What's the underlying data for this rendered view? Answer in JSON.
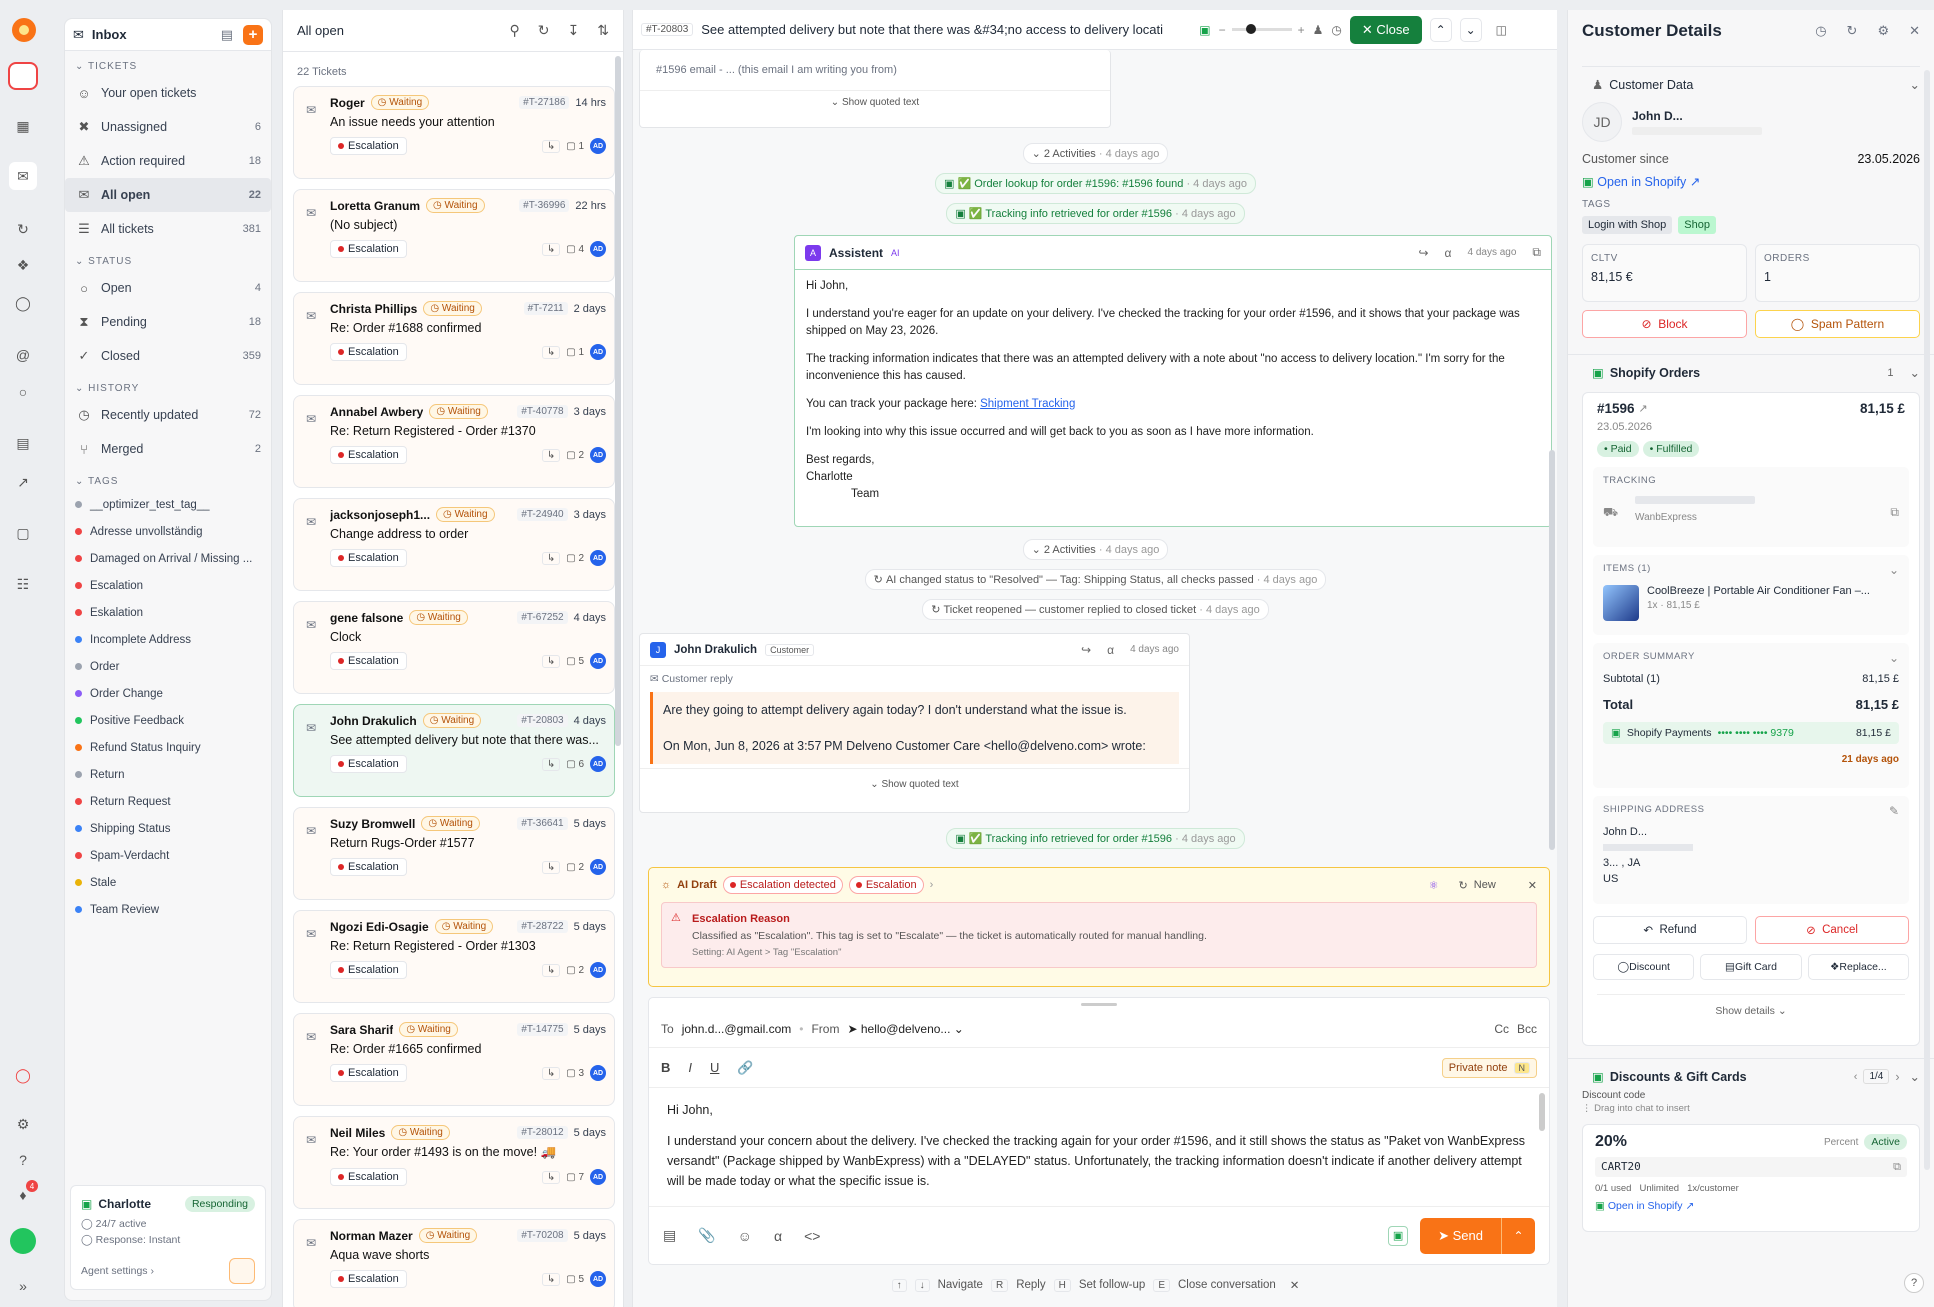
{
  "rail": {
    "icons": [
      "logo-icon",
      "app-box-icon",
      "grid-icon",
      "inbox-icon",
      "refresh-icon",
      "cube-icon",
      "shield-icon",
      "at-icon",
      "chat-icon",
      "bar-chart-icon",
      "line-chart-icon",
      "message-icon",
      "book-icon",
      "alert-shield-icon",
      "settings-icon",
      "help-icon",
      "bell-icon",
      "avatar-icon",
      "expand-icon"
    ],
    "bell_badge": "4"
  },
  "nav": {
    "title": "Inbox",
    "sections": {
      "tickets": "TICKETS",
      "status": "STATUS",
      "history": "HISTORY",
      "tags": "TAGS"
    },
    "tickets": [
      {
        "label": "Your open tickets",
        "count": "",
        "icon": "☺"
      },
      {
        "label": "Unassigned",
        "count": "6",
        "icon": "✖"
      },
      {
        "label": "Action required",
        "count": "18",
        "icon": "⚠"
      },
      {
        "label": "All open",
        "count": "22",
        "icon": "✉"
      },
      {
        "label": "All tickets",
        "count": "381",
        "icon": "☰"
      }
    ],
    "status": [
      {
        "label": "Open",
        "count": "4",
        "icon": "○"
      },
      {
        "label": "Pending",
        "count": "18",
        "icon": "⧗"
      },
      {
        "label": "Closed",
        "count": "359",
        "icon": "✓"
      }
    ],
    "history": [
      {
        "label": "Recently updated",
        "count": "72",
        "icon": "◷"
      },
      {
        "label": "Merged",
        "count": "2",
        "icon": "⑂"
      }
    ],
    "tags": [
      {
        "label": "__optimizer_test_tag__",
        "color": "#9ca3af"
      },
      {
        "label": "Adresse unvollständig",
        "color": "#ef4444"
      },
      {
        "label": "Damaged on Arrival / Missing ...",
        "color": "#ef4444"
      },
      {
        "label": "Escalation",
        "color": "#ef4444"
      },
      {
        "label": "Eskalation",
        "color": "#ef4444"
      },
      {
        "label": "Incomplete Address",
        "color": "#3b82f6"
      },
      {
        "label": "Order",
        "color": "#9ca3af"
      },
      {
        "label": "Order Change",
        "color": "#8b5cf6"
      },
      {
        "label": "Positive Feedback",
        "color": "#22c55e"
      },
      {
        "label": "Refund Status Inquiry",
        "color": "#f97316"
      },
      {
        "label": "Return",
        "color": "#9ca3af"
      },
      {
        "label": "Return Request",
        "color": "#ef4444"
      },
      {
        "label": "Shipping Status",
        "color": "#3b82f6"
      },
      {
        "label": "Spam-Verdacht",
        "color": "#ef4444"
      },
      {
        "label": "Stale",
        "color": "#eab308"
      },
      {
        "label": "Team Review",
        "color": "#3b82f6"
      }
    ],
    "agent": {
      "name": "Charlotte",
      "status": "Responding",
      "active": "24/7 active",
      "response": "Response: Instant",
      "settings": "Agent settings"
    }
  },
  "list": {
    "title": "All open",
    "count": "22 Tickets",
    "status": "Waiting",
    "tag": "Escalation",
    "avatar": "AD",
    "tickets": [
      {
        "name": "Roger",
        "id": "#T-27186",
        "time": "14 hrs",
        "subject": "An issue needs your attention",
        "msgs": "1"
      },
      {
        "name": "Loretta Granum",
        "id": "#T-36996",
        "time": "22 hrs",
        "subject": "(No subject)",
        "msgs": "4"
      },
      {
        "name": "Christa Phillips",
        "id": "#T-7211",
        "time": "2 days",
        "subject": "Re: Order #1688 confirmed",
        "msgs": "1"
      },
      {
        "name": "Annabel Awbery",
        "id": "#T-40778",
        "time": "3 days",
        "subject": "Re: Return Registered - Order #1370",
        "msgs": "2"
      },
      {
        "name": "jacksonjoseph1...",
        "id": "#T-24940",
        "time": "3 days",
        "subject": "Change address to order",
        "msgs": "2"
      },
      {
        "name": "gene falsone",
        "id": "#T-67252",
        "time": "4 days",
        "subject": "Clock",
        "msgs": "5"
      },
      {
        "name": "John Drakulich",
        "id": "#T-20803",
        "time": "4 days",
        "subject": "See attempted delivery but note that there was...",
        "msgs": "6"
      },
      {
        "name": "Suzy Bromwell",
        "id": "#T-36641",
        "time": "5 days",
        "subject": "Return Rugs-Order #1577",
        "msgs": "2"
      },
      {
        "name": "Ngozi Edi-Osagie",
        "id": "#T-28722",
        "time": "5 days",
        "subject": "Re: Return Registered - Order #1303",
        "msgs": "2"
      },
      {
        "name": "Sara Sharif",
        "id": "#T-14775",
        "time": "5 days",
        "subject": "Re: Order #1665 confirmed",
        "msgs": "3"
      },
      {
        "name": "Neil Miles",
        "id": "#T-28012",
        "time": "5 days",
        "subject": "Re: Your order #1493 is on the move! 🚚",
        "msgs": "7"
      },
      {
        "name": "Norman Mazer",
        "id": "#T-70208",
        "time": "5 days",
        "subject": "Aqua wave shorts",
        "msgs": "5"
      }
    ]
  },
  "conv": {
    "id": "#T-20803",
    "title": "See attempted delivery but note that there was &#34;no access to delivery locati",
    "close": "Close",
    "quoted_top": "#1596 email - ... (this email I am writing you from)",
    "show_quoted": "Show quoted text",
    "activities": "2 Activities",
    "ago": "· 4 days ago",
    "ev1": "✅ Order lookup for order #1596: #1596 found",
    "ev2": "✅ Tracking info retrieved for order #1596",
    "assistant": {
      "name": "Assistent",
      "badge": "AI",
      "time": "4 days ago",
      "p1": "Hi John,",
      "p2": "I understand you're eager for an update on your delivery. I've checked the tracking for your order #1596, and it shows that your package was shipped on May 23, 2026.",
      "p3": "The tracking information indicates that there was an attempted delivery with a note about \"no access to delivery location.\" I'm sorry for the inconvenience this has caused.",
      "p4a": "You can track your package here: ",
      "p4link": "Shipment Tracking",
      "p5": "I'm looking into why this issue occurred and will get back to you as soon as I have more information.",
      "p6": "Best regards,",
      "p7": "Charlotte",
      "p8": "Team"
    },
    "ev3": "AI changed status to \"Resolved\" — Tag: Shipping Status, all checks passed",
    "ev4": "Ticket reopened — customer replied to closed ticket",
    "customer": {
      "name": "John Drakulich",
      "badge": "Customer",
      "time": "4 days ago",
      "reply_label": "Customer reply",
      "q": "Are they going to attempt delivery again today?  I don't understand what the issue is.",
      "quote": "On Mon, Jun 8, 2026 at 3:57 PM Delveno Customer Care <hello@delveno.com> wrote:"
    },
    "draft": {
      "label": "AI Draft",
      "det": "Escalation detected",
      "tag": "Escalation",
      "new": "New",
      "reason_title": "Escalation Reason",
      "reason": "Classified as \"Escalation\". This tag is set to \"Escalate\" — the ticket is automatically routed for manual handling.",
      "setting": "Setting: AI Agent > Tag \"Escalation\""
    },
    "composer": {
      "to_label": "To",
      "to": "john.d...@gmail.com",
      "from_label": "From",
      "from": "hello@delveno...",
      "cc": "Cc",
      "bcc": "Bcc",
      "private": "Private note",
      "private_key": "N",
      "l1": "Hi John,",
      "l2": "I understand your concern about the delivery. I've checked the tracking again for your order #1596, and it still shows the status as \"Paket von WanbExpress versandt\" (Package shipped by WanbExpress) with a \"DELAYED\" status. Unfortunately, the tracking information doesn't indicate if another delivery attempt will be made today or what the specific issue is.",
      "send": "Send"
    },
    "shortcuts": {
      "navigate": "Navigate",
      "r": "R",
      "reply": "Reply",
      "h": "H",
      "followup": "Set follow-up",
      "e": "E",
      "close": "Close conversation"
    }
  },
  "details": {
    "title": "Customer Details",
    "customer_data": "Customer Data",
    "initials": "JD",
    "name": "John D...",
    "since_label": "Customer since",
    "since": "23.05.2026",
    "open_shopify": "Open in Shopify",
    "tags_label": "TAGS",
    "tags": [
      "Login with Shop",
      "Shop"
    ],
    "cltv_label": "CLTV",
    "cltv": "81,15 €",
    "orders_label": "ORDERS",
    "orders": "1",
    "block": "Block",
    "spam": "Spam Pattern",
    "shopify_orders": "Shopify Orders",
    "orders_count": "1",
    "order": {
      "id": "#1596",
      "total": "81,15 £",
      "date": "23.05.2026",
      "paid": "Paid",
      "fulfilled": "Fulfilled",
      "tracking_label": "TRACKING",
      "carrier": "WanbExpress",
      "items_label": "ITEMS (1)",
      "item": "CoolBreeze | Portable Air Conditioner Fan –...",
      "item_qty": "1x · 81,15 £",
      "summary_label": "ORDER SUMMARY",
      "subtotal_label": "Subtotal (1)",
      "subtotal": "81,15 £",
      "total_label": "Total",
      "payment": "Shopify Payments",
      "card": "•••• •••• •••• 9379",
      "payment_amt": "81,15 £",
      "ago": "21 days ago",
      "ship_label": "SHIPPING ADDRESS",
      "ship1": "John D...",
      "ship2": "3... , JA",
      "ship3": "US"
    },
    "refund": "Refund",
    "cancel": "Cancel",
    "discount": "Discount",
    "gift": "Gift Card",
    "replace": "Replace...",
    "show_details": "Show details",
    "discounts": {
      "title": "Discounts & Gift Cards",
      "page": "1/4",
      "code_label": "Discount code",
      "drag": "Drag into chat to insert",
      "pct": "20%",
      "type": "Percent",
      "active": "Active",
      "code": "CART20",
      "used": "0/1 used",
      "unlimited": "Unlimited",
      "per": "1x/customer",
      "open": "Open in Shopify"
    }
  }
}
